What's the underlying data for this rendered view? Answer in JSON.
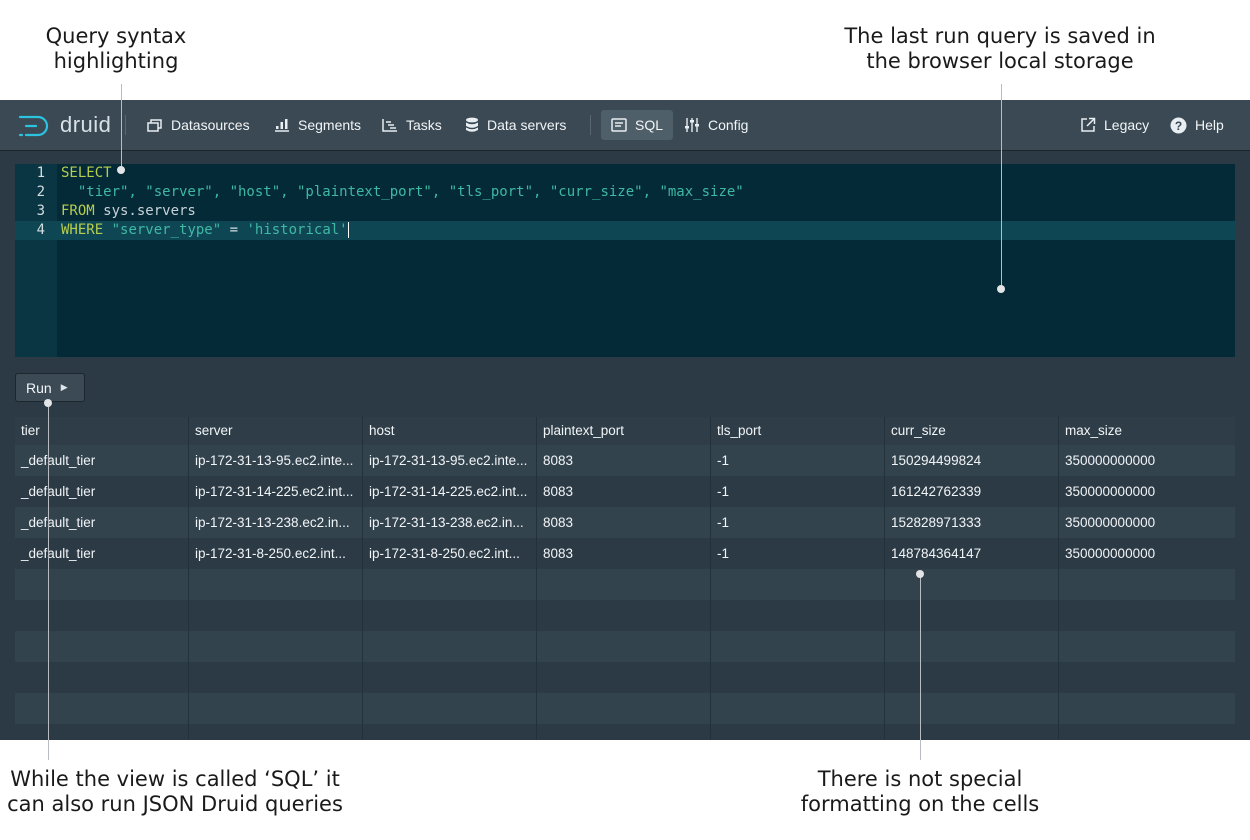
{
  "annotations": {
    "syntax": [
      "Query syntax",
      "highlighting"
    ],
    "storage": [
      "The last run query is saved in",
      "the browser local storage"
    ],
    "sql_view": [
      "While the view is called ‘SQL’ it",
      "can also run JSON Druid queries"
    ],
    "formatting": [
      "There is not special",
      "formatting on the cells"
    ]
  },
  "navbar": {
    "logo": "druid",
    "items": [
      {
        "label": "Datasources",
        "icon": "datasources-icon"
      },
      {
        "label": "Segments",
        "icon": "segments-icon"
      },
      {
        "label": "Tasks",
        "icon": "tasks-icon"
      },
      {
        "label": "Data servers",
        "icon": "database-icon"
      },
      {
        "label": "SQL",
        "icon": "sql-icon",
        "active": true
      },
      {
        "label": "Config",
        "icon": "config-icon"
      }
    ],
    "right_items": [
      {
        "label": "Legacy",
        "icon": "external-link-icon"
      },
      {
        "label": "Help",
        "icon": "help-icon"
      }
    ]
  },
  "editor": {
    "line_numbers": [
      "1",
      "2",
      "3",
      "4"
    ],
    "lines": [
      "SELECT",
      "  \"tier\", \"server\", \"host\", \"plaintext_port\", \"tls_port\", \"curr_size\", \"max_size\"",
      "FROM sys.servers",
      "WHERE \"server_type\" = 'historical'"
    ]
  },
  "run_button": {
    "label": "Run"
  },
  "table": {
    "columns": [
      "tier",
      "server",
      "host",
      "plaintext_port",
      "tls_port",
      "curr_size",
      "max_size"
    ],
    "rows": [
      [
        "_default_tier",
        "ip-172-31-13-95.ec2.inte...",
        "ip-172-31-13-95.ec2.inte...",
        "8083",
        "-1",
        "150294499824",
        "350000000000"
      ],
      [
        "_default_tier",
        "ip-172-31-14-225.ec2.int...",
        "ip-172-31-14-225.ec2.int...",
        "8083",
        "-1",
        "161242762339",
        "350000000000"
      ],
      [
        "_default_tier",
        "ip-172-31-13-238.ec2.in...",
        "ip-172-31-13-238.ec2.in...",
        "8083",
        "-1",
        "152828971333",
        "350000000000"
      ],
      [
        "_default_tier",
        "ip-172-31-8-250.ec2.int...",
        "ip-172-31-8-250.ec2.int...",
        "8083",
        "-1",
        "148784364147",
        "350000000000"
      ]
    ]
  },
  "colors": {
    "navbar": "#3a4953",
    "editor_bg": "#042a37",
    "keyword": "#b7cd4f",
    "string": "#3fb8a4",
    "app_bg": "#2b3a44"
  }
}
